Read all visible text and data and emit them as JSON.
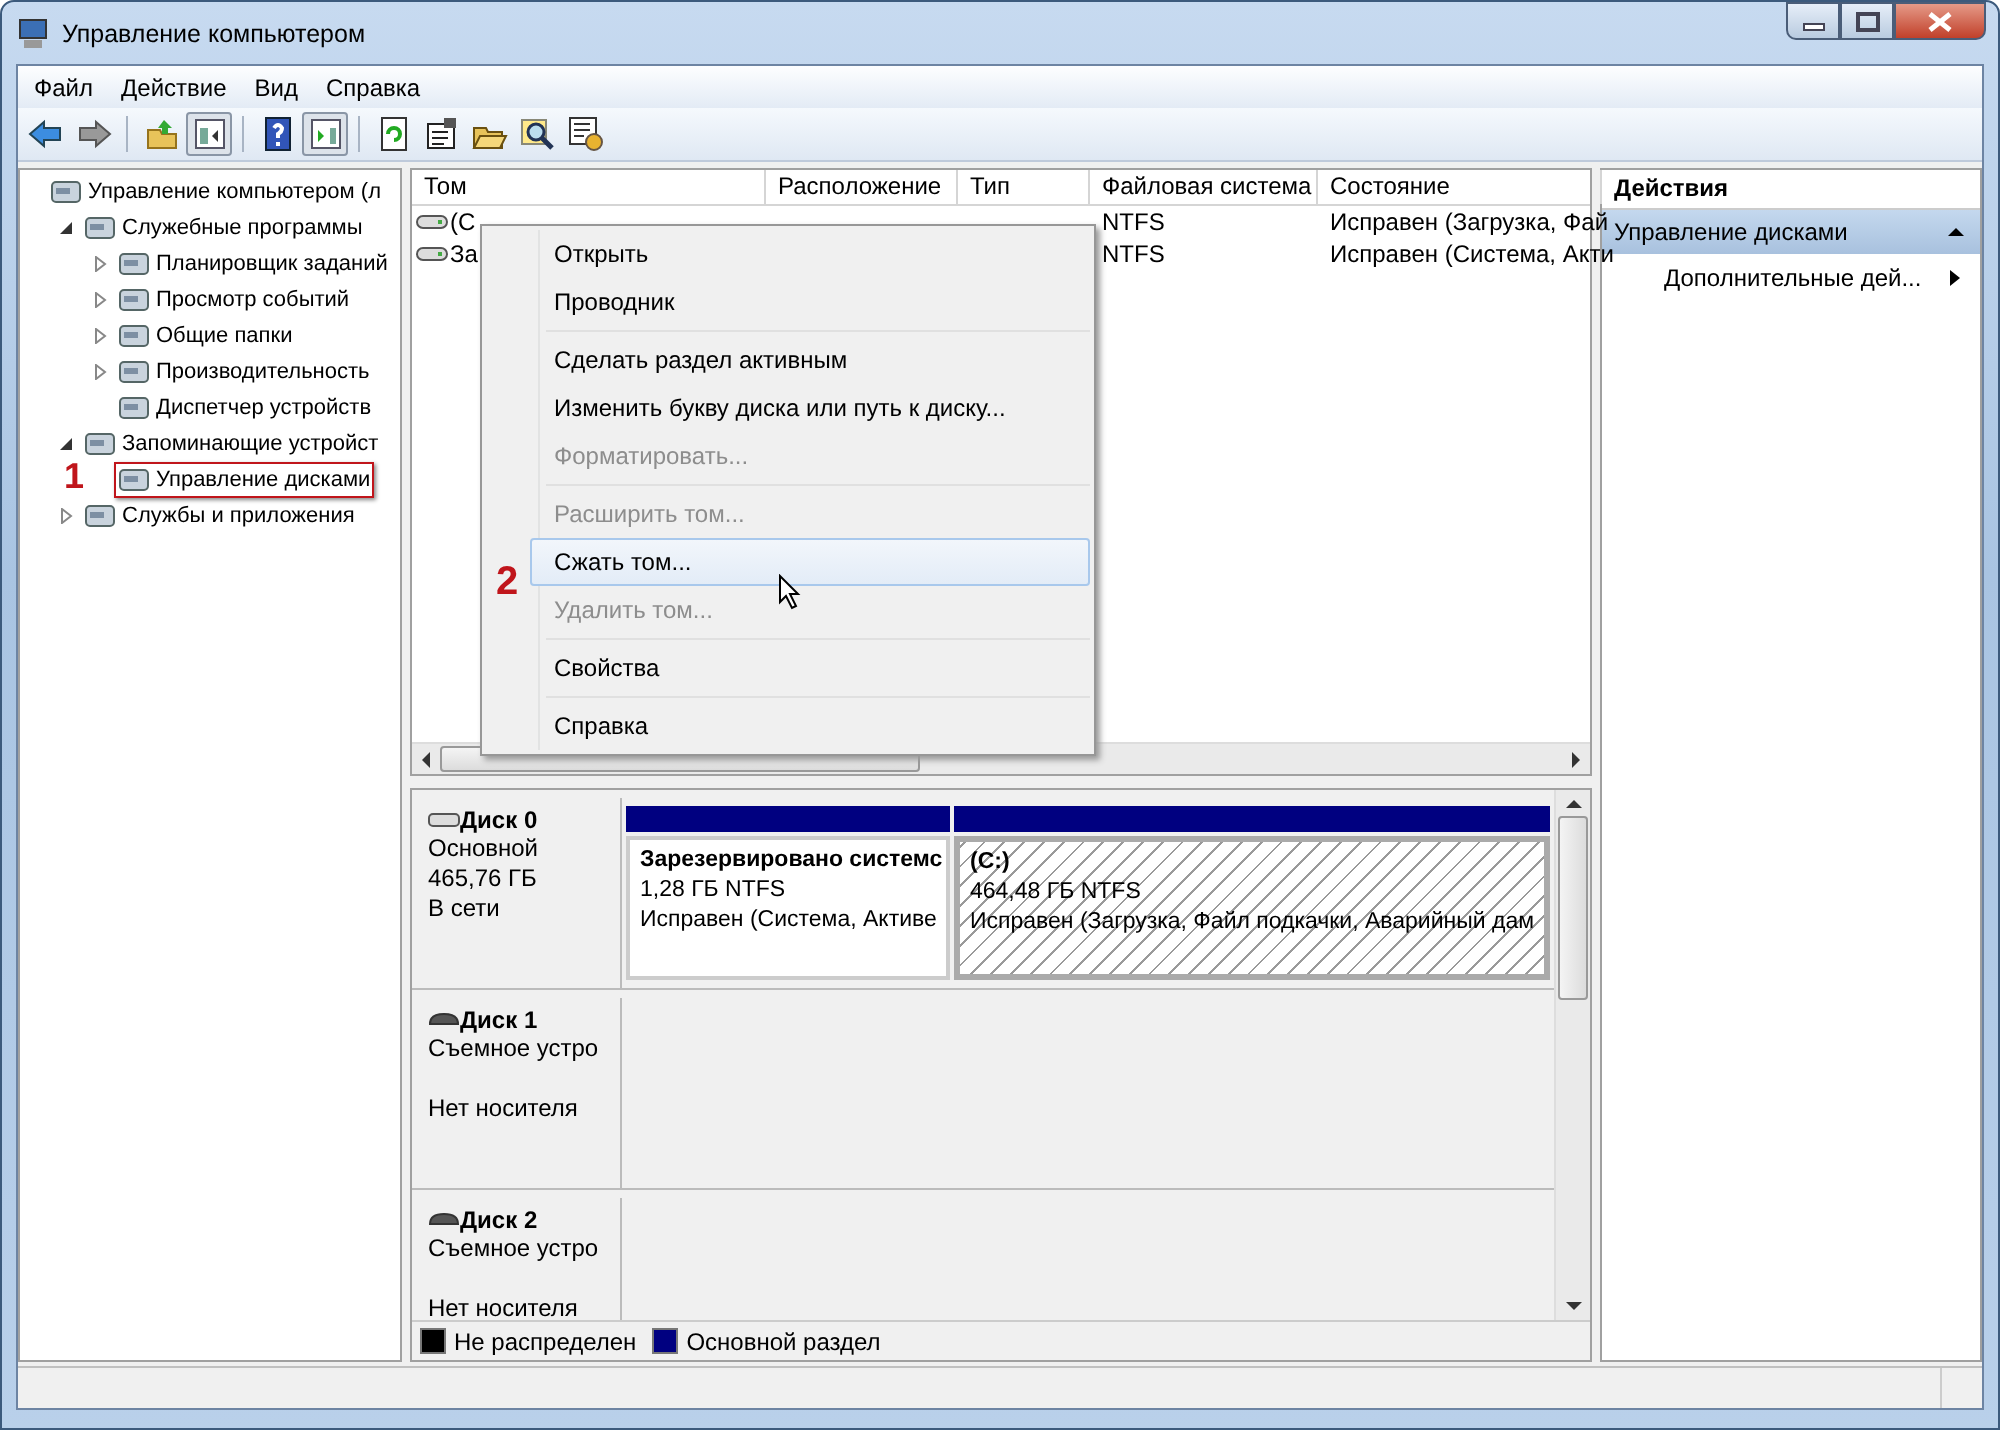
{
  "window": {
    "title": "Управление компьютером"
  },
  "menu": [
    "Файл",
    "Действие",
    "Вид",
    "Справка"
  ],
  "toolbar": [
    {
      "kind": "back",
      "disabled": false
    },
    {
      "kind": "forward",
      "disabled": true
    },
    {
      "kind": "separator"
    },
    {
      "kind": "up"
    },
    {
      "kind": "tree",
      "pressed": true
    },
    {
      "kind": "separator"
    },
    {
      "kind": "help"
    },
    {
      "kind": "panel",
      "pressed": true
    },
    {
      "kind": "separator"
    },
    {
      "kind": "refresh"
    },
    {
      "kind": "properties"
    },
    {
      "kind": "open"
    },
    {
      "kind": "search"
    },
    {
      "kind": "settings"
    }
  ],
  "tree": [
    {
      "label": "Управление компьютером (л",
      "kind": "root",
      "selected": false,
      "children": [
        {
          "label": "Служебные программы",
          "kind": "node",
          "expanded": true,
          "selected": false,
          "children": [
            {
              "label": "Планировщик заданий",
              "kind": "node",
              "expanded": false,
              "selected": false
            },
            {
              "label": "Просмотр событий",
              "kind": "node",
              "expanded": false,
              "selected": false
            },
            {
              "label": "Общие папки",
              "kind": "node",
              "expanded": false,
              "selected": false
            },
            {
              "label": "Производительность",
              "kind": "node",
              "expanded": false,
              "selected": false
            },
            {
              "label": "Диспетчер устройств",
              "kind": "leaf",
              "selected": false
            }
          ]
        },
        {
          "label": "Запоминающие устройст",
          "kind": "node",
          "expanded": true,
          "selected": false,
          "children": [
            {
              "label": "Управление дисками",
              "kind": "leaf",
              "selected": true,
              "callout": "1"
            }
          ]
        },
        {
          "label": "Службы и приложения",
          "kind": "node",
          "expanded": false,
          "selected": false
        }
      ]
    }
  ],
  "volumes": {
    "columns": [
      "Том",
      "Расположение",
      "Тип",
      "Файловая система",
      "Состояние"
    ],
    "rows": [
      {
        "volume": "(C",
        "file_system": "NTFS",
        "status": "Исправен (Загрузка, Фай"
      },
      {
        "volume": "За",
        "file_system": "NTFS",
        "status": "Исправен (Система, Акти"
      }
    ]
  },
  "context_menu": [
    {
      "kind": "item",
      "label": "Открыть",
      "disabled": false,
      "selected": false
    },
    {
      "kind": "item",
      "label": "Проводник",
      "disabled": false,
      "selected": false
    },
    {
      "kind": "separator"
    },
    {
      "kind": "item",
      "label": "Сделать раздел активным",
      "disabled": false,
      "selected": false
    },
    {
      "kind": "item",
      "label": "Изменить букву диска или путь к диску...",
      "disabled": false,
      "selected": false
    },
    {
      "kind": "item",
      "label": "Форматировать...",
      "disabled": true,
      "selected": false
    },
    {
      "kind": "separator"
    },
    {
      "kind": "item",
      "label": "Расширить том...",
      "disabled": true,
      "selected": false
    },
    {
      "kind": "item",
      "label": "Сжать том...",
      "disabled": false,
      "selected": true,
      "callout": "2"
    },
    {
      "kind": "item",
      "label": "Удалить том...",
      "disabled": true,
      "selected": false
    },
    {
      "kind": "separator"
    },
    {
      "kind": "item",
      "label": "Свойства",
      "disabled": false,
      "selected": false
    },
    {
      "kind": "separator"
    },
    {
      "kind": "item",
      "label": "Справка",
      "disabled": false,
      "selected": false
    }
  ],
  "disks": [
    {
      "name": "Диск 0",
      "kind": "fixed",
      "type": "Основной",
      "size": "465,76 ГБ",
      "status": "В сети",
      "partitions": [
        {
          "name": "Зарезервировано системс",
          "size": "1,28 ГБ NTFS",
          "status": "Исправен (Система, Активе",
          "selected": false
        },
        {
          "name": "(C:)",
          "size": "464,48 ГБ NTFS",
          "status": "Исправен (Загрузка, Файл подкачки, Аварийный дам",
          "selected": true
        }
      ]
    },
    {
      "name": "Диск 1",
      "kind": "removable",
      "type": "Съемное устро",
      "status": "Нет носителя"
    },
    {
      "name": "Диск 2",
      "kind": "removable",
      "type": "Съемное устро",
      "status": "Нет носителя"
    }
  ],
  "legend": [
    {
      "label": "Не распределен",
      "color": "#000000"
    },
    {
      "label": "Основной раздел",
      "color": "#000080"
    }
  ],
  "actions": {
    "title": "Действия",
    "sections": [
      {
        "label": "Управление дисками",
        "expanded": true,
        "items": [
          "Дополнительные дей..."
        ]
      }
    ]
  }
}
